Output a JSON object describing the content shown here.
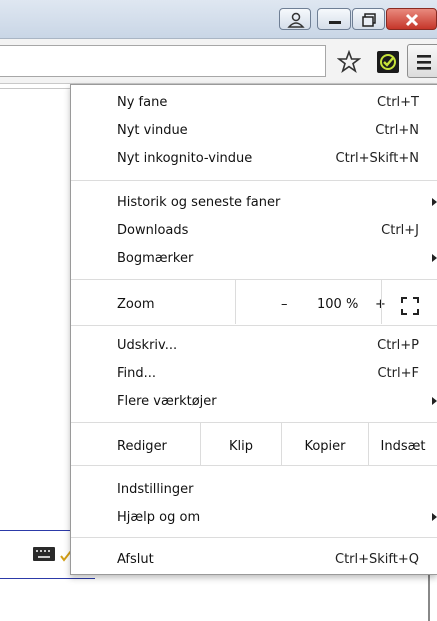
{
  "menu": {
    "items_group1": [
      {
        "label": "Ny fane",
        "shortcut": "Ctrl+T"
      },
      {
        "label": "Nyt vindue",
        "shortcut": "Ctrl+N"
      },
      {
        "label": "Nyt inkognito-vindue",
        "shortcut": "Ctrl+Skift+N"
      }
    ],
    "items_group2": [
      {
        "label": "Historik og seneste faner"
      },
      {
        "label": "Downloads",
        "shortcut": "Ctrl+J"
      },
      {
        "label": "Bogmærker"
      }
    ],
    "zoom": {
      "label": "Zoom",
      "minus": "–",
      "value": "100 %",
      "plus": "+"
    },
    "items_group3": [
      {
        "label": "Udskriv...",
        "shortcut": "Ctrl+P"
      },
      {
        "label": "Find...",
        "shortcut": "Ctrl+F"
      },
      {
        "label": "Flere værktøjer"
      }
    ],
    "edit": {
      "label": "Rediger",
      "cut": "Klip",
      "copy": "Kopier",
      "paste": "Indsæt"
    },
    "items_group4": [
      {
        "label": "Indstillinger"
      },
      {
        "label": "Hjælp og om"
      }
    ],
    "exit": {
      "label": "Afslut",
      "shortcut": "Ctrl+Skift+Q"
    }
  },
  "icons": {
    "user": "user-icon",
    "minimize": "minimize-icon",
    "maximize": "restore-icon",
    "close": "close-icon",
    "bookmark": "star-icon",
    "extension": "checkmark-extension-icon",
    "menu": "hamburger-menu-icon",
    "fullscreen": "fullscreen-icon"
  },
  "colors": {
    "close_button": "#c5362a",
    "extension_bg": "#1b1b1b",
    "extension_check": "#c7e23a"
  }
}
